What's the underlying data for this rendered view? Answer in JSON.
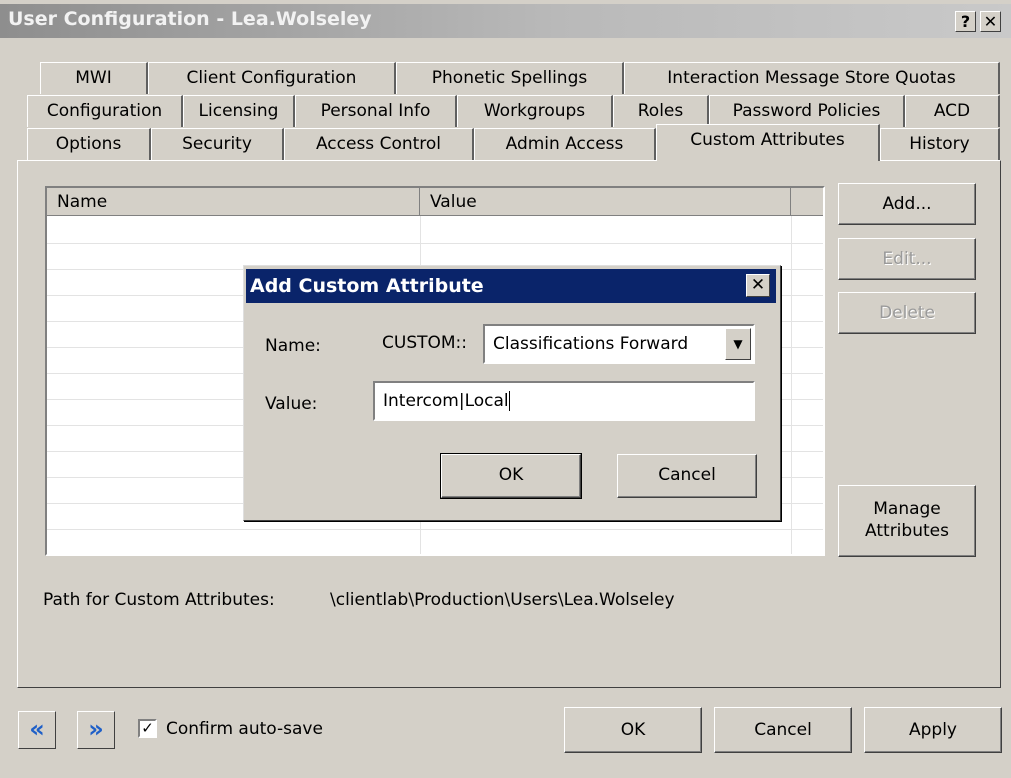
{
  "window": {
    "title": "User Configuration - Lea.Wolseley",
    "help_glyph": "?",
    "close_glyph": "✕"
  },
  "tabs": {
    "row1": [
      "MWI",
      "Client Configuration",
      "Phonetic Spellings",
      "Interaction Message Store Quotas"
    ],
    "row2": [
      "Configuration",
      "Licensing",
      "Personal Info",
      "Workgroups",
      "Roles",
      "Password Policies",
      "ACD"
    ],
    "row3": [
      "Options",
      "Security",
      "Access Control",
      "Admin Access",
      "Custom Attributes",
      "History"
    ],
    "active": "Custom Attributes"
  },
  "table": {
    "col_name": "Name",
    "col_value": "Value"
  },
  "side_buttons": {
    "add": "Add...",
    "edit": "Edit...",
    "delete": "Delete",
    "manage_line1": "Manage",
    "manage_line2": "Attributes"
  },
  "path": {
    "label": "Path for Custom Attributes:",
    "value": "\\clientlab\\Production\\Users\\Lea.Wolseley"
  },
  "dialog": {
    "title": "Add Custom Attribute",
    "close_glyph": "✕",
    "name_label": "Name:",
    "prefix": "CUSTOM::",
    "name_value": "Classifications Forward",
    "dropdown_glyph": "▼",
    "value_label": "Value:",
    "value_value": "Intercom|Local",
    "ok": "OK",
    "cancel": "Cancel"
  },
  "footer": {
    "prev_glyph": "«",
    "next_glyph": "»",
    "confirm_label": "Confirm auto-save",
    "confirm_checked": true,
    "check_glyph": "✓",
    "ok": "OK",
    "cancel": "Cancel",
    "apply": "Apply"
  }
}
